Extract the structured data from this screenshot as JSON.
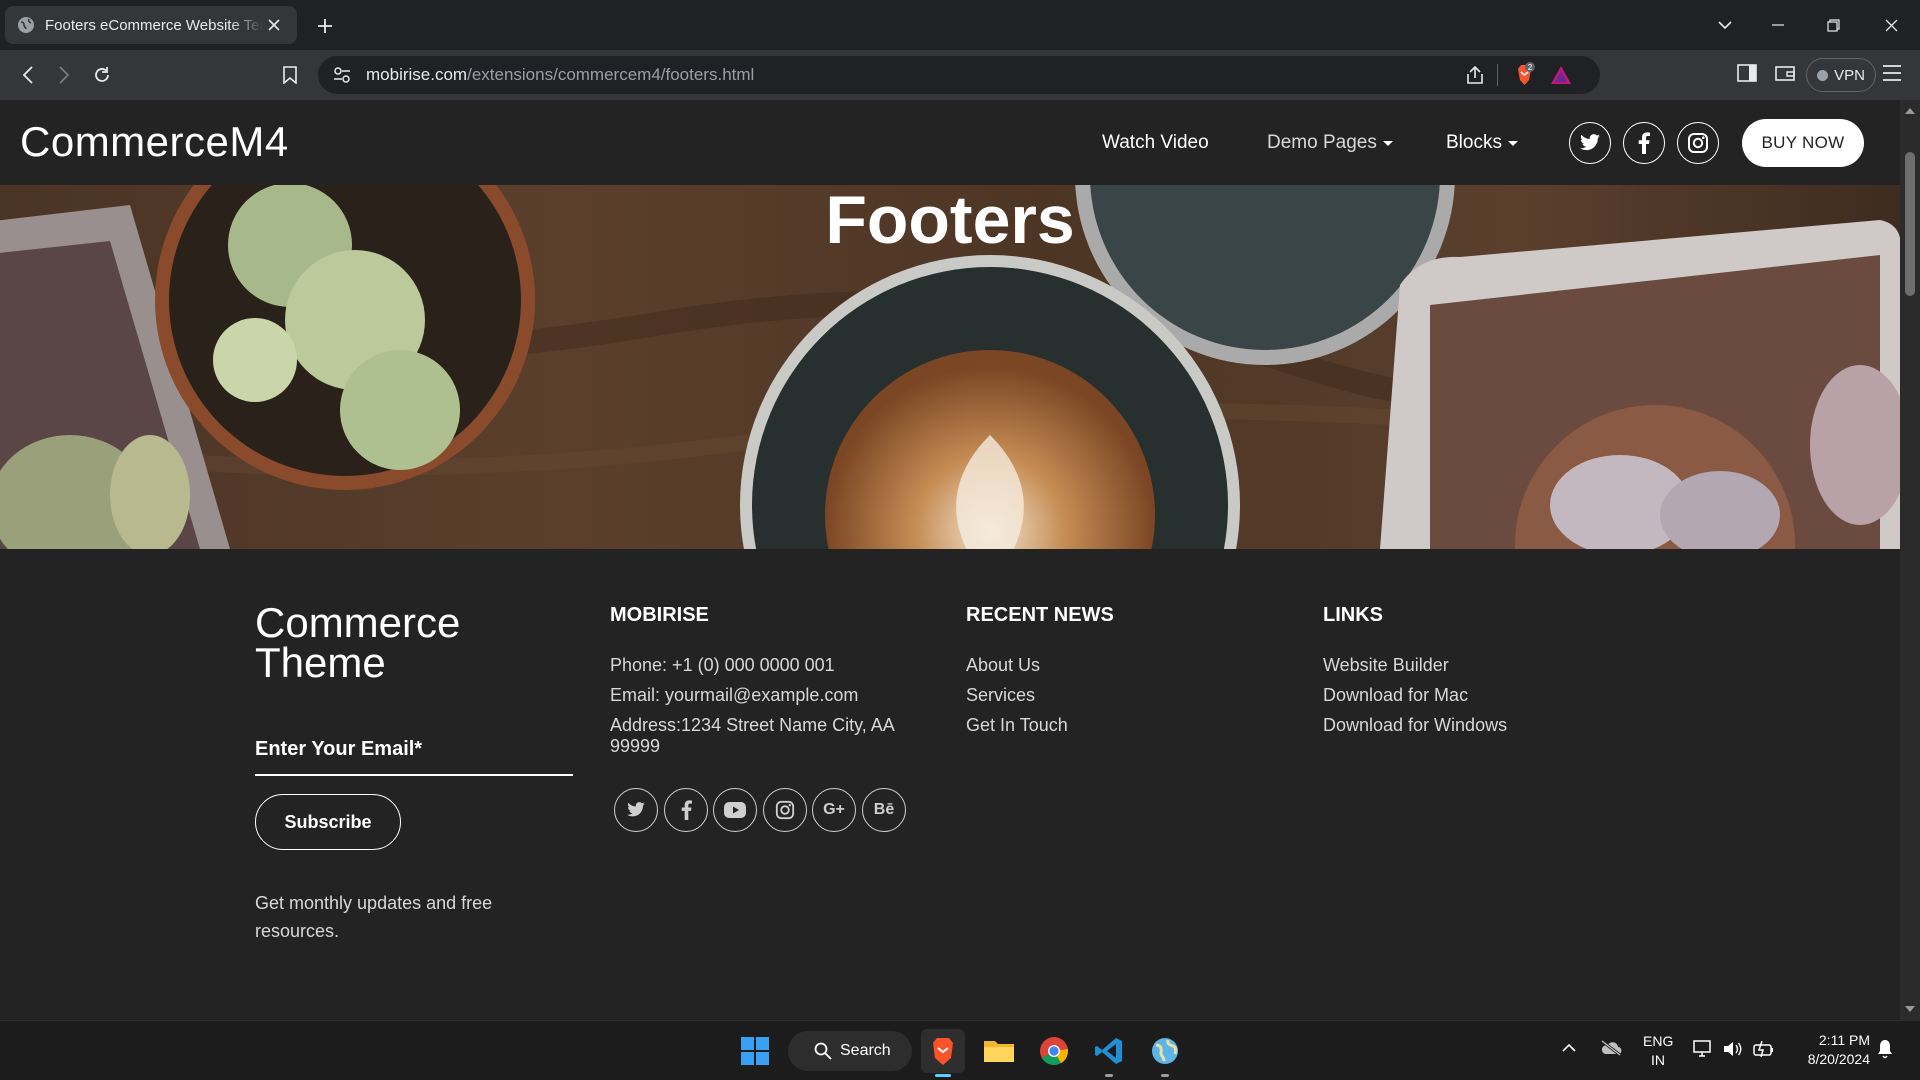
{
  "browser": {
    "tab_title": "Footers eCommerce Website Template",
    "url_host": "mobirise.com",
    "url_path": "/extensions/commercem4/footers.html",
    "vpn_label": "VPN",
    "shield_count": "2"
  },
  "navbar": {
    "brand": "CommerceM4",
    "links": [
      "Watch Video",
      "Demo Pages",
      "Blocks"
    ],
    "social_icons": [
      "twitter-icon",
      "facebook-icon",
      "instagram-icon"
    ],
    "buy_label": "BUY NOW"
  },
  "hero": {
    "title": "Footers"
  },
  "footer": {
    "brand_line1": "Commerce",
    "brand_line2": "Theme",
    "email_label": "Enter Your Email*",
    "subscribe_label": "Subscribe",
    "note": "Get monthly updates and free resources.",
    "col1": {
      "heading": "MOBIRISE",
      "phone": "Phone: +1 (0) 000 0000 001",
      "email": "Email: yourmail@example.com",
      "address": "Address:1234 Street Name City, AA 99999"
    },
    "col2": {
      "heading": "RECENT NEWS",
      "items": [
        "About Us",
        "Services",
        "Get In Touch"
      ]
    },
    "col3": {
      "heading": "LINKS",
      "items": [
        "Website Builder",
        "Download for Mac",
        "Download for Windows"
      ]
    },
    "social_icons": [
      "twitter-icon",
      "facebook-icon",
      "youtube-icon",
      "instagram-icon",
      "google-plus-icon",
      "behance-icon"
    ],
    "google_plus_glyph": "G+",
    "behance_glyph": "Bē"
  },
  "taskbar": {
    "search_label": "Search",
    "lang_line1": "ENG",
    "lang_line2": "IN",
    "time": "2:11 PM",
    "date": "8/20/2024"
  }
}
